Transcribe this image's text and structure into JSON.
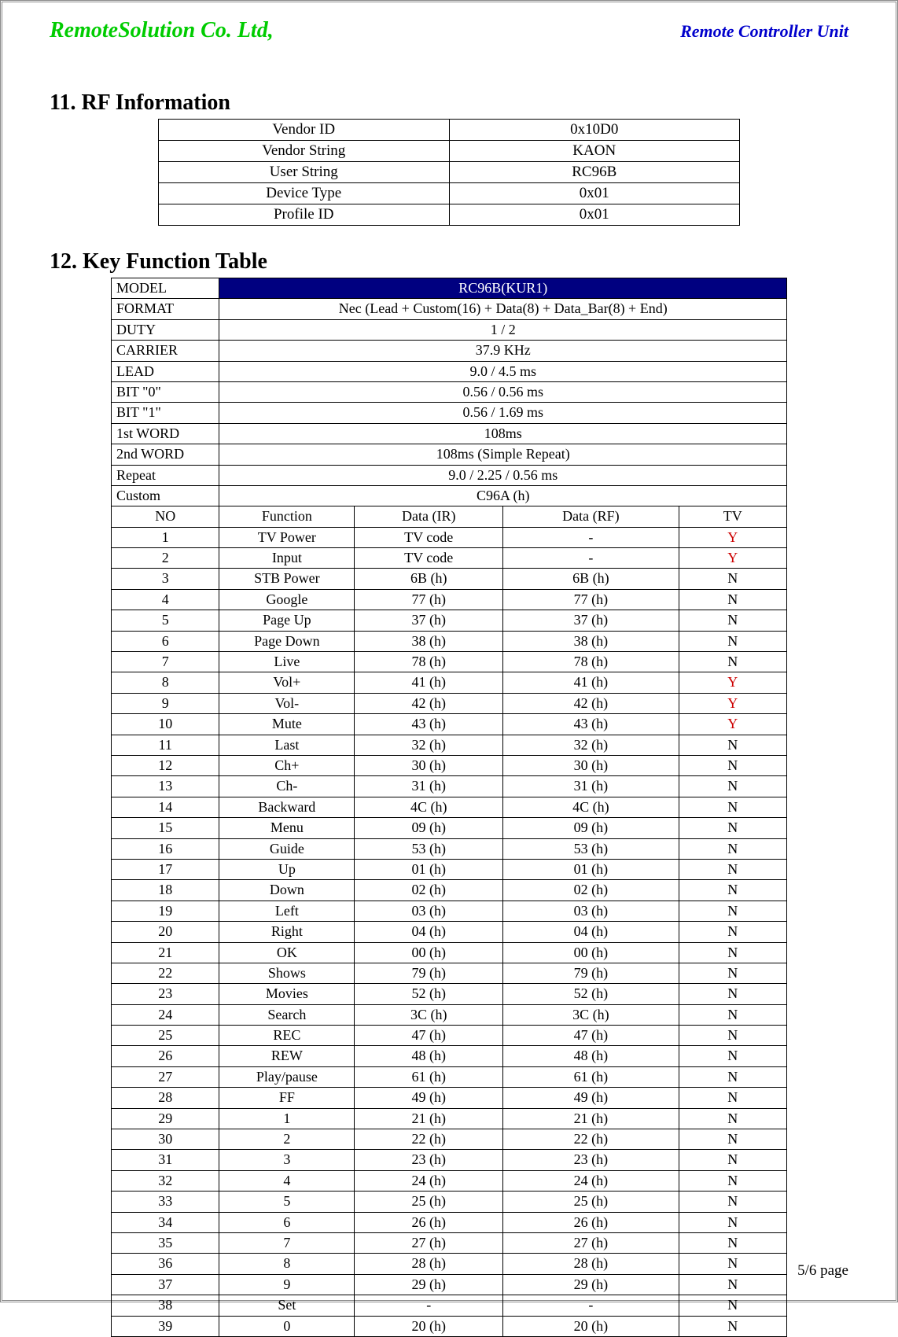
{
  "header": {
    "company": "RemoteSolution Co. Ltd,",
    "unit": "Remote Controller Unit"
  },
  "section11": {
    "title": "11.  RF Information",
    "rows": [
      {
        "label": "Vendor ID",
        "value": "0x10D0"
      },
      {
        "label": "Vendor String",
        "value": "KAON"
      },
      {
        "label": "User String",
        "value": "RC96B"
      },
      {
        "label": "Device Type",
        "value": "0x01"
      },
      {
        "label": "Profile ID",
        "value": "0x01"
      }
    ]
  },
  "section12": {
    "title": "12.  Key Function Table",
    "meta": [
      {
        "label": "MODEL",
        "value": "RC96B(KUR1)",
        "model": true
      },
      {
        "label": "FORMAT",
        "value": "Nec (Lead + Custom(16) + Data(8) + Data_Bar(8) + End)"
      },
      {
        "label": "DUTY",
        "value": "1 / 2"
      },
      {
        "label": "CARRIER",
        "value": "37.9 KHz"
      },
      {
        "label": "LEAD",
        "value": "9.0 / 4.5 ms"
      },
      {
        "label": "BIT \"0\"",
        "value": "0.56 / 0.56 ms"
      },
      {
        "label": "BIT \"1\"",
        "value": "0.56 / 1.69 ms"
      },
      {
        "label": "1st WORD",
        "value": "108ms"
      },
      {
        "label": "2nd WORD",
        "value": "108ms (Simple Repeat)"
      },
      {
        "label": "Repeat",
        "value": "9.0 / 2.25 / 0.56 ms"
      },
      {
        "label": "Custom",
        "value": "C96A (h)"
      }
    ],
    "columns": {
      "no": "NO",
      "func": "Function",
      "ir": "Data (IR)",
      "rf": "Data (RF)",
      "tv": "TV"
    },
    "rows": [
      {
        "no": "1",
        "func": "TV Power",
        "ir": "TV code",
        "rf": "-",
        "tv": "Y"
      },
      {
        "no": "2",
        "func": "Input",
        "ir": "TV code",
        "rf": "-",
        "tv": "Y"
      },
      {
        "no": "3",
        "func": "STB Power",
        "ir": "6B (h)",
        "rf": "6B (h)",
        "tv": "N"
      },
      {
        "no": "4",
        "func": "Google",
        "ir": "77 (h)",
        "rf": "77 (h)",
        "tv": "N"
      },
      {
        "no": "5",
        "func": "Page Up",
        "ir": "37 (h)",
        "rf": "37 (h)",
        "tv": "N"
      },
      {
        "no": "6",
        "func": "Page Down",
        "ir": "38 (h)",
        "rf": "38 (h)",
        "tv": "N"
      },
      {
        "no": "7",
        "func": "Live",
        "ir": "78 (h)",
        "rf": "78 (h)",
        "tv": "N"
      },
      {
        "no": "8",
        "func": "Vol+",
        "ir": "41 (h)",
        "rf": "41 (h)",
        "tv": "Y"
      },
      {
        "no": "9",
        "func": "Vol-",
        "ir": "42 (h)",
        "rf": "42 (h)",
        "tv": "Y"
      },
      {
        "no": "10",
        "func": "Mute",
        "ir": "43 (h)",
        "rf": "43 (h)",
        "tv": "Y"
      },
      {
        "no": "11",
        "func": "Last",
        "ir": "32 (h)",
        "rf": "32 (h)",
        "tv": "N"
      },
      {
        "no": "12",
        "func": "Ch+",
        "ir": "30 (h)",
        "rf": "30 (h)",
        "tv": "N"
      },
      {
        "no": "13",
        "func": "Ch-",
        "ir": "31 (h)",
        "rf": "31 (h)",
        "tv": "N"
      },
      {
        "no": "14",
        "func": "Backward",
        "ir": "4C (h)",
        "rf": "4C (h)",
        "tv": "N"
      },
      {
        "no": "15",
        "func": "Menu",
        "ir": "09 (h)",
        "rf": "09 (h)",
        "tv": "N"
      },
      {
        "no": "16",
        "func": "Guide",
        "ir": "53 (h)",
        "rf": "53 (h)",
        "tv": "N"
      },
      {
        "no": "17",
        "func": "Up",
        "ir": "01 (h)",
        "rf": "01 (h)",
        "tv": "N"
      },
      {
        "no": "18",
        "func": "Down",
        "ir": "02 (h)",
        "rf": "02 (h)",
        "tv": "N"
      },
      {
        "no": "19",
        "func": "Left",
        "ir": "03 (h)",
        "rf": "03 (h)",
        "tv": "N"
      },
      {
        "no": "20",
        "func": "Right",
        "ir": "04 (h)",
        "rf": "04 (h)",
        "tv": "N"
      },
      {
        "no": "21",
        "func": "OK",
        "ir": "00 (h)",
        "rf": "00 (h)",
        "tv": "N"
      },
      {
        "no": "22",
        "func": "Shows",
        "ir": "79 (h)",
        "rf": "79 (h)",
        "tv": "N"
      },
      {
        "no": "23",
        "func": "Movies",
        "ir": "52 (h)",
        "rf": "52 (h)",
        "tv": "N"
      },
      {
        "no": "24",
        "func": "Search",
        "ir": "3C (h)",
        "rf": "3C (h)",
        "tv": "N"
      },
      {
        "no": "25",
        "func": "REC",
        "ir": "47 (h)",
        "rf": "47 (h)",
        "tv": "N"
      },
      {
        "no": "26",
        "func": "REW",
        "ir": "48 (h)",
        "rf": "48 (h)",
        "tv": "N"
      },
      {
        "no": "27",
        "func": "Play/pause",
        "ir": "61 (h)",
        "rf": "61 (h)",
        "tv": "N"
      },
      {
        "no": "28",
        "func": "FF",
        "ir": "49 (h)",
        "rf": "49 (h)",
        "tv": "N"
      },
      {
        "no": "29",
        "func": "1",
        "ir": "21 (h)",
        "rf": "21 (h)",
        "tv": "N"
      },
      {
        "no": "30",
        "func": "2",
        "ir": "22 (h)",
        "rf": "22 (h)",
        "tv": "N"
      },
      {
        "no": "31",
        "func": "3",
        "ir": "23 (h)",
        "rf": "23 (h)",
        "tv": "N"
      },
      {
        "no": "32",
        "func": "4",
        "ir": "24 (h)",
        "rf": "24 (h)",
        "tv": "N"
      },
      {
        "no": "33",
        "func": "5",
        "ir": "25 (h)",
        "rf": "25 (h)",
        "tv": "N"
      },
      {
        "no": "34",
        "func": "6",
        "ir": "26 (h)",
        "rf": "26 (h)",
        "tv": "N"
      },
      {
        "no": "35",
        "func": "7",
        "ir": "27 (h)",
        "rf": "27 (h)",
        "tv": "N"
      },
      {
        "no": "36",
        "func": "8",
        "ir": "28 (h)",
        "rf": "28 (h)",
        "tv": "N"
      },
      {
        "no": "37",
        "func": "9",
        "ir": "29 (h)",
        "rf": "29 (h)",
        "tv": "N"
      },
      {
        "no": "38",
        "func": "Set",
        "ir": "-",
        "rf": "-",
        "tv": "N"
      },
      {
        "no": "39",
        "func": "0",
        "ir": "20 (h)",
        "rf": "20 (h)",
        "tv": "N"
      }
    ]
  },
  "footer": {
    "page": "5/6 page"
  }
}
